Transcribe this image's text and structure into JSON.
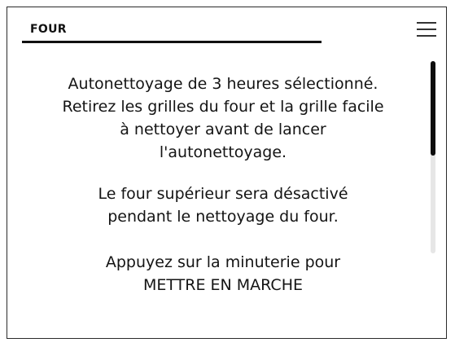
{
  "header": {
    "title": "FOUR"
  },
  "icons": {
    "menu": "hamburger-menu-icon"
  },
  "message": {
    "paragraph1_line1": "Autonettoyage de 3 heures sélectionné.",
    "paragraph1_line2": "Retirez les grilles du four et la grille facile",
    "paragraph1_line3": "à nettoyer avant de lancer",
    "paragraph1_line4": "l'autonettoyage.",
    "paragraph2_line1": "Le four supérieur sera désactivé",
    "paragraph2_line2": "pendant le nettoyage du four.",
    "paragraph3_line1": "Appuyez sur la minuterie pour",
    "paragraph3_line2": "METTRE EN MARCHE"
  },
  "scroll": {
    "position_fraction": 0.0,
    "visible_fraction": 0.49
  }
}
